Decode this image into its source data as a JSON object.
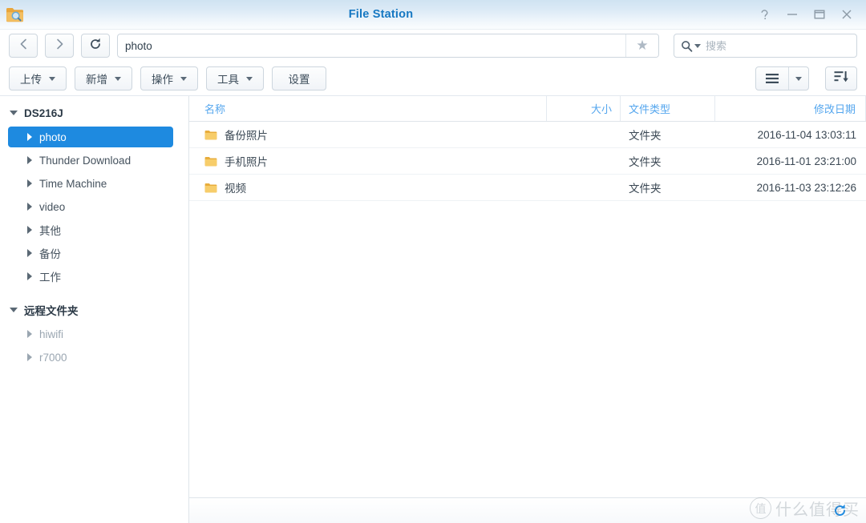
{
  "window": {
    "title": "File Station",
    "app_icon": "folder-search-icon",
    "controls": [
      {
        "name": "help",
        "glyph": "?"
      },
      {
        "name": "minimize",
        "glyph": "—"
      },
      {
        "name": "maximize",
        "glyph": "□"
      },
      {
        "name": "close",
        "glyph": "✕"
      }
    ]
  },
  "nav": {
    "back_icon": "chevron-left-icon",
    "forward_icon": "chevron-right-icon",
    "refresh_icon": "refresh-icon",
    "path_value": "photo",
    "path_placeholder": "",
    "favorite_icon": "star-icon"
  },
  "search": {
    "icon": "search-icon",
    "placeholder": "搜索",
    "value": ""
  },
  "toolbar": {
    "buttons": [
      {
        "label": "上传",
        "has_caret": true
      },
      {
        "label": "新增",
        "has_caret": true
      },
      {
        "label": "操作",
        "has_caret": true
      },
      {
        "label": "工具",
        "has_caret": true
      },
      {
        "label": "设置",
        "has_caret": false
      }
    ],
    "view_button_icon": "list-view-icon",
    "view_caret_icon": "chevron-down-icon",
    "sort_button_icon": "sort-descending-icon"
  },
  "sidebar": {
    "groups": [
      {
        "label": "DS216J",
        "expanded": true,
        "items": [
          {
            "label": "photo",
            "selected": true,
            "dim": false
          },
          {
            "label": "Thunder Download",
            "selected": false,
            "dim": false
          },
          {
            "label": "Time Machine",
            "selected": false,
            "dim": false
          },
          {
            "label": "video",
            "selected": false,
            "dim": false
          },
          {
            "label": "其他",
            "selected": false,
            "dim": false
          },
          {
            "label": "备份",
            "selected": false,
            "dim": false
          },
          {
            "label": "工作",
            "selected": false,
            "dim": false
          }
        ]
      },
      {
        "label": "远程文件夹",
        "expanded": true,
        "items": [
          {
            "label": "hiwifi",
            "selected": false,
            "dim": true
          },
          {
            "label": "r7000",
            "selected": false,
            "dim": true
          }
        ]
      }
    ]
  },
  "file_list": {
    "columns": [
      {
        "key": "name",
        "label": "名称"
      },
      {
        "key": "size",
        "label": "大小"
      },
      {
        "key": "type",
        "label": "文件类型"
      },
      {
        "key": "date",
        "label": "修改日期"
      }
    ],
    "rows": [
      {
        "icon": "folder-icon",
        "name": "备份照片",
        "size": "",
        "type": "文件夹",
        "date": "2016-11-04 13:03:11"
      },
      {
        "icon": "folder-icon",
        "name": "手机照片",
        "size": "",
        "type": "文件夹",
        "date": "2016-11-01 23:21:00"
      },
      {
        "icon": "folder-icon",
        "name": "视频",
        "size": "",
        "type": "文件夹",
        "date": "2016-11-03 23:12:26"
      }
    ]
  },
  "statusbar": {
    "text": "",
    "refresh_icon": "sync-icon"
  },
  "watermark": {
    "badge": "值",
    "text": "什么值得买"
  },
  "colors": {
    "accent": "#1e8ae0",
    "header_text": "#54a6ee",
    "title_text": "#1678c2",
    "folder": "#f2c14e"
  }
}
